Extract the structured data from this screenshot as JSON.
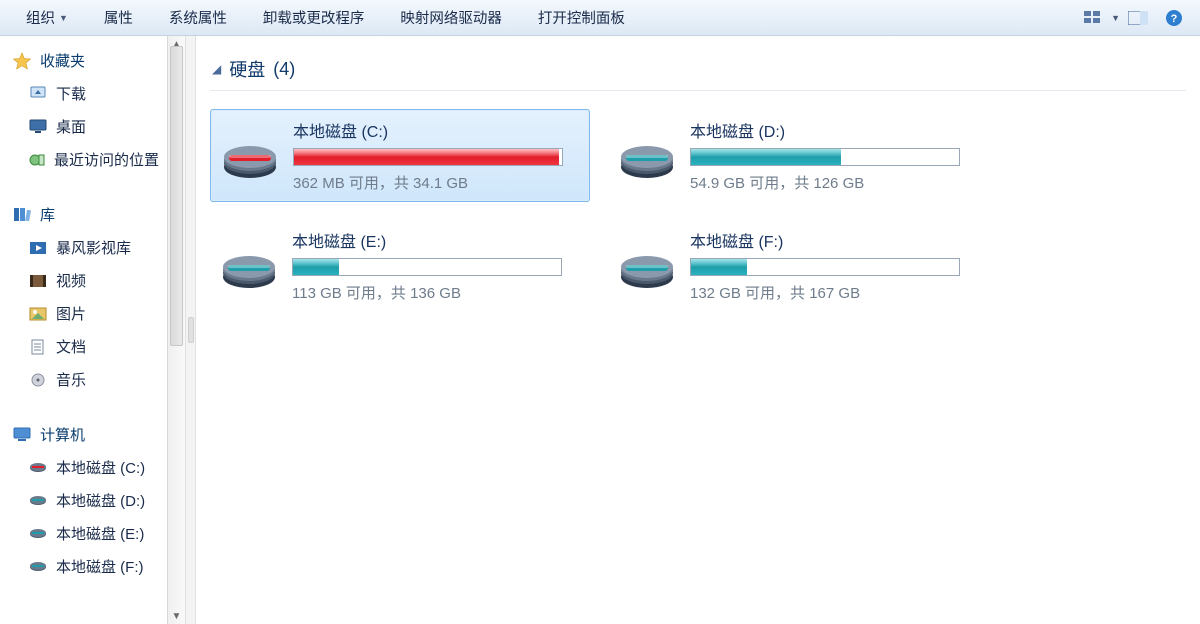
{
  "toolbar": {
    "organize_label": "组织",
    "properties_label": "属性",
    "system_properties_label": "系统属性",
    "uninstall_label": "卸载或更改程序",
    "map_drive_label": "映射网络驱动器",
    "open_control_panel_label": "打开控制面板"
  },
  "sidebar": {
    "favorites": {
      "header": "收藏夹",
      "items": [
        {
          "icon": "download-icon",
          "label": "下载"
        },
        {
          "icon": "desktop-icon",
          "label": "桌面"
        },
        {
          "icon": "recent-icon",
          "label": "最近访问的位置"
        }
      ]
    },
    "libraries": {
      "header": "库",
      "items": [
        {
          "icon": "video-lib-icon",
          "label": "暴风影视库"
        },
        {
          "icon": "videos-icon",
          "label": "视频"
        },
        {
          "icon": "pictures-icon",
          "label": "图片"
        },
        {
          "icon": "documents-icon",
          "label": "文档"
        },
        {
          "icon": "music-icon",
          "label": "音乐"
        }
      ]
    },
    "computer": {
      "header": "计算机",
      "items": [
        {
          "icon": "drive-red-icon",
          "label": "本地磁盘 (C:)"
        },
        {
          "icon": "drive-blue-icon",
          "label": "本地磁盘 (D:)"
        },
        {
          "icon": "drive-blue-icon",
          "label": "本地磁盘 (E:)"
        },
        {
          "icon": "drive-blue-icon",
          "label": "本地磁盘 (F:)"
        }
      ]
    }
  },
  "main": {
    "section_label": "硬盘",
    "section_count": "(4)",
    "drives": [
      {
        "name": "本地磁盘 (C:)",
        "stats": "362 MB 可用，共 34.1 GB",
        "fill_pct": 99,
        "fill_color": "red",
        "selected": true
      },
      {
        "name": "本地磁盘 (D:)",
        "stats": "54.9 GB 可用，共 126 GB",
        "fill_pct": 56,
        "fill_color": "teal",
        "selected": false
      },
      {
        "name": "本地磁盘 (E:)",
        "stats": "113 GB 可用，共 136 GB",
        "fill_pct": 17,
        "fill_color": "teal",
        "selected": false
      },
      {
        "name": "本地磁盘 (F:)",
        "stats": "132 GB 可用，共 167 GB",
        "fill_pct": 21,
        "fill_color": "teal",
        "selected": false
      }
    ]
  }
}
